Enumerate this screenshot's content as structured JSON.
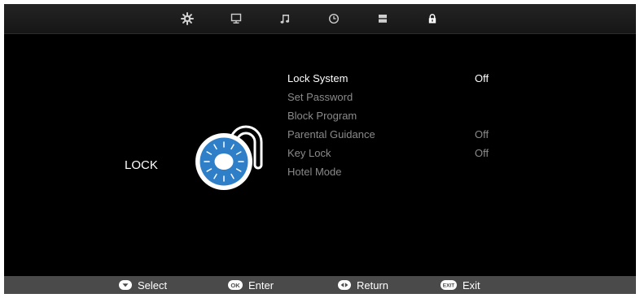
{
  "tabs": [
    {
      "name": "picture-settings-icon"
    },
    {
      "name": "screen-icon"
    },
    {
      "name": "music-note-icon"
    },
    {
      "name": "clock-icon"
    },
    {
      "name": "options-icon"
    },
    {
      "name": "padlock-icon",
      "active": true
    }
  ],
  "page_title": "LOCK",
  "illustration": {
    "name": "combination-lock-icon",
    "accent": "#2e7fc8"
  },
  "menu": {
    "items": [
      {
        "label": "Lock System",
        "value": "Off",
        "selected": true
      },
      {
        "label": "Set Password",
        "value": ""
      },
      {
        "label": "Block Program",
        "value": ""
      },
      {
        "label": "Parental Guidance",
        "value": "Off"
      },
      {
        "label": "Key Lock",
        "value": "Off"
      },
      {
        "label": "Hotel Mode",
        "value": ""
      }
    ]
  },
  "footer": {
    "select": {
      "icon": "down-arrow-button-icon",
      "label": "Select"
    },
    "enter": {
      "icon": "ok-button-icon",
      "icon_text": "OK",
      "label": "Enter"
    },
    "return": {
      "icon": "left-right-button-icon",
      "label": "Return"
    },
    "exit": {
      "icon": "exit-button-icon",
      "icon_text": "EXIT",
      "label": "Exit"
    }
  },
  "colors": {
    "selected_text": "#ffffff",
    "unselected_text": "#8a8a8a",
    "footer_bg": "#4a4a4a",
    "background": "#000000"
  }
}
